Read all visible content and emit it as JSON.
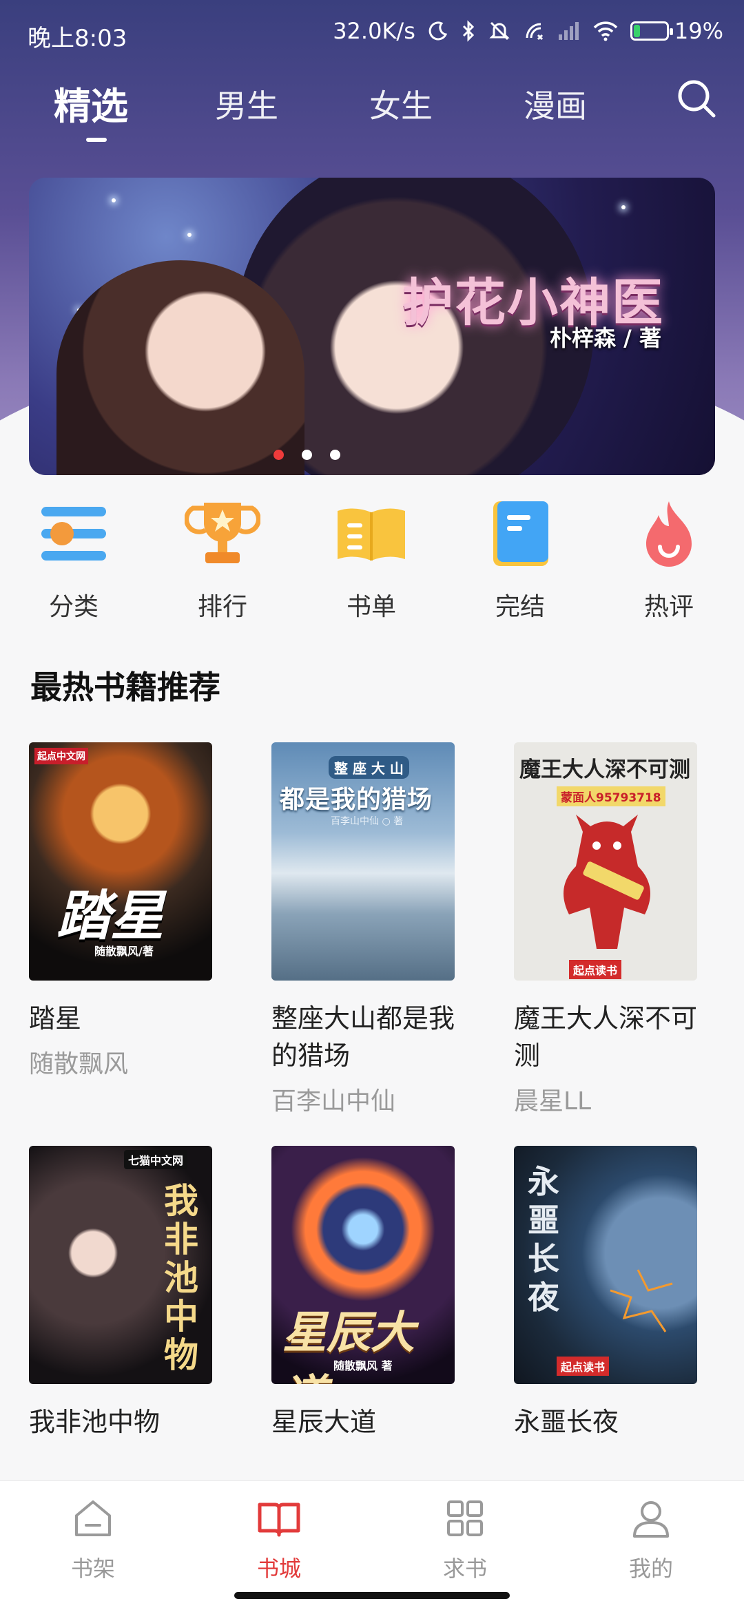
{
  "status_bar": {
    "time": "晚上8:03",
    "speed": "32.0K/s",
    "battery": "19%",
    "battery_level": 0.19
  },
  "top_tabs": [
    {
      "label": "精选",
      "active": true
    },
    {
      "label": "男生",
      "active": false
    },
    {
      "label": "女生",
      "active": false
    },
    {
      "label": "漫画",
      "active": false
    }
  ],
  "banner": {
    "title": "护花小神医",
    "author": "朴梓森 / 著",
    "slide_count": 3,
    "active_slide": 1
  },
  "categories": [
    {
      "label": "分类",
      "icon": "category-icon"
    },
    {
      "label": "排行",
      "icon": "trophy-icon"
    },
    {
      "label": "书单",
      "icon": "booklist-icon"
    },
    {
      "label": "完结",
      "icon": "finished-book-icon"
    },
    {
      "label": "热评",
      "icon": "flame-icon"
    }
  ],
  "section": {
    "title": "最热书籍推荐"
  },
  "books": [
    {
      "title": "踏星",
      "author": "随散飘风",
      "cover_text": "踏星",
      "cover_author": "随散飘风/著",
      "cover_tag": "起点中文网"
    },
    {
      "title": "整座大山都是我的猎场",
      "author": "百李山中仙",
      "cover_text": "都是我的猎场",
      "cover_top": "整 座 大 山",
      "cover_author": "百李山中仙 ○ 著"
    },
    {
      "title": "魔王大人深不可测",
      "author": "晨星LL",
      "cover_text": "魔王大人深不可测",
      "cover_sub": "蒙面人95793718",
      "cover_tag": "起点读书"
    },
    {
      "title": "我非池中物",
      "author": "",
      "cover_text": "我非池中物",
      "cover_tag": "七猫中文网"
    },
    {
      "title": "星辰大道",
      "author": "",
      "cover_text": "星辰大道",
      "cover_author": "随散飘风 著"
    },
    {
      "title": "永噩长夜",
      "author": "",
      "cover_text": "永噩长夜",
      "cover_tag": "起点读书"
    }
  ],
  "bottom_nav": [
    {
      "label": "书架",
      "icon": "bookshelf-icon",
      "active": false
    },
    {
      "label": "书城",
      "icon": "book-open-icon",
      "active": true
    },
    {
      "label": "求书",
      "icon": "grid-icon",
      "active": false
    },
    {
      "label": "我的",
      "icon": "person-icon",
      "active": false
    }
  ],
  "colors": {
    "accent": "#e23b3b",
    "header": "#4a4a8c"
  }
}
